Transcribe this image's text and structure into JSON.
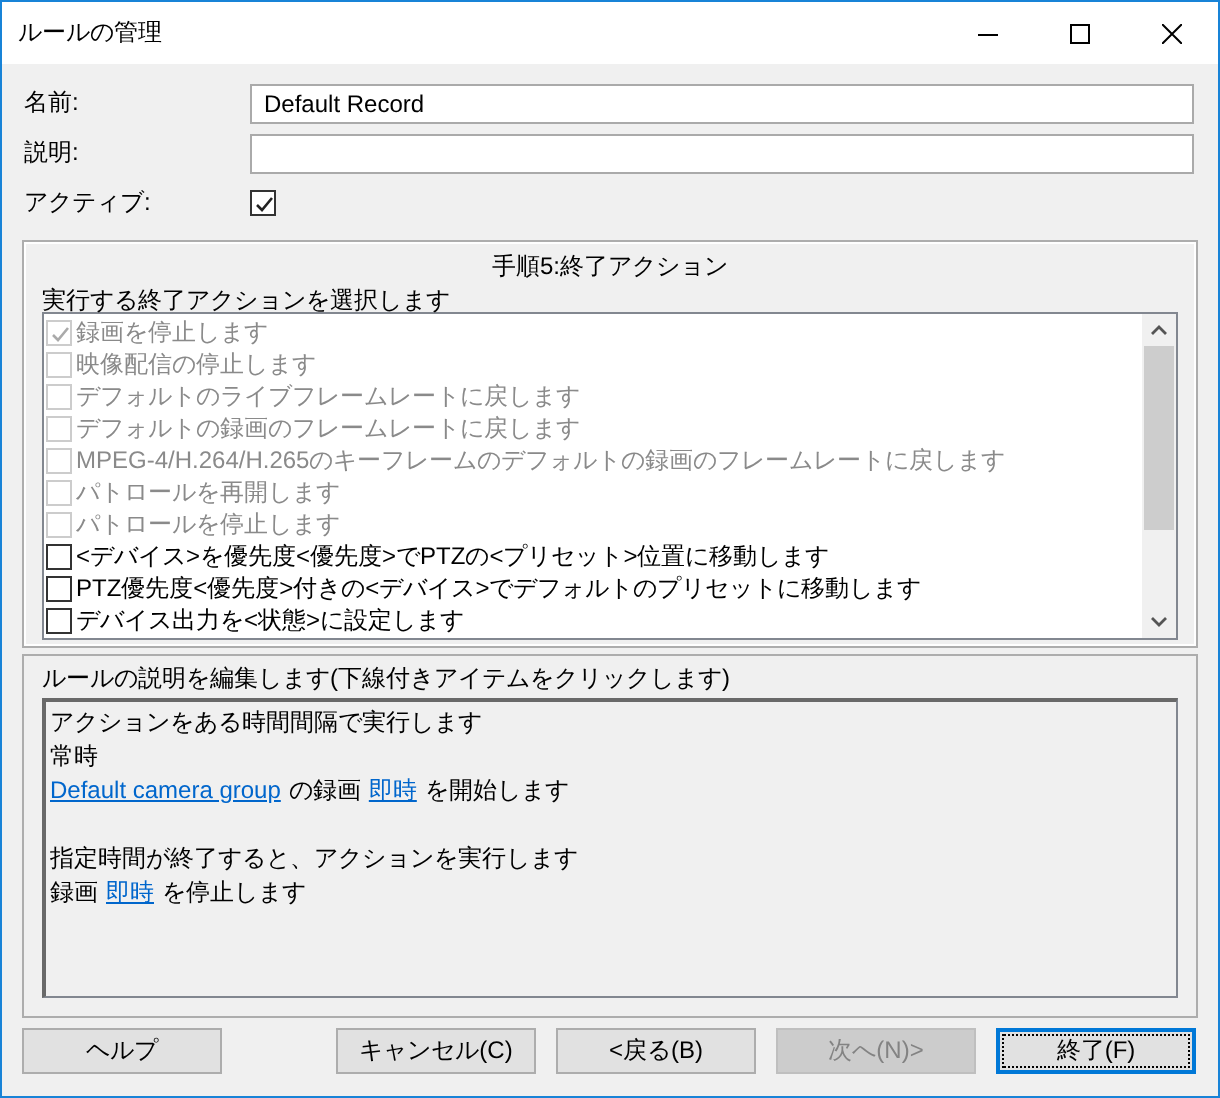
{
  "window": {
    "title": "ルールの管理"
  },
  "fields": [
    {
      "kind": "text",
      "label": "名前:",
      "value": "Default Record"
    },
    {
      "kind": "text",
      "label": "説明:"
    },
    {
      "kind": "checkbox",
      "label": "アクティブ:",
      "checked": true
    }
  ],
  "step": {
    "title": "手順5:終了アクション",
    "prompt": "実行する終了アクションを選択します",
    "actions": [
      {
        "label": "録画を停止します",
        "checked": true,
        "disabled": true
      },
      {
        "label": "映像配信の停止します",
        "checked": false,
        "disabled": true
      },
      {
        "label": "デフォルトのライブフレームレートに戻します",
        "checked": false,
        "disabled": true
      },
      {
        "label": "デフォルトの録画のフレームレートに戻します",
        "checked": false,
        "disabled": true
      },
      {
        "label": "MPEG-4/H.264/H.265のキーフレームのデフォルトの録画のフレームレートに戻します",
        "checked": false,
        "disabled": true
      },
      {
        "label": "パトロールを再開します",
        "checked": false,
        "disabled": true
      },
      {
        "label": "パトロールを停止します",
        "checked": false,
        "disabled": true
      },
      {
        "label": "<デバイス>を優先度<優先度>でPTZの<プリセット>位置に移動します",
        "checked": false,
        "disabled": false
      },
      {
        "label": "PTZ優先度<優先度>付きの<デバイス>でデフォルトのプリセットに移動します",
        "checked": false,
        "disabled": false
      },
      {
        "label": "デバイス出力を<状態>に設定します",
        "checked": false,
        "disabled": false
      }
    ]
  },
  "description": {
    "title": "ルールの説明を編集します(下線付きアイテムをクリックします)",
    "paragraphs": [
      [
        [
          {
            "kind": "text",
            "text": "アクションをある時間間隔で実行します"
          }
        ],
        [
          {
            "kind": "text",
            "text": "常時"
          }
        ],
        [
          {
            "kind": "link",
            "text": "Default camera group"
          },
          {
            "kind": "text",
            "text": "の録画"
          },
          {
            "kind": "link",
            "text": "即時"
          },
          {
            "kind": "text",
            "text": "を開始します"
          }
        ]
      ],
      [
        [
          {
            "kind": "text",
            "text": "指定時間が終了すると、アクションを実行します"
          }
        ],
        [
          {
            "kind": "text",
            "text": "録画"
          },
          {
            "kind": "link",
            "text": "即時"
          },
          {
            "kind": "text",
            "text": "を停止します"
          }
        ]
      ]
    ]
  },
  "buttons": [
    {
      "label": "ヘルプ",
      "disabled": false,
      "default": false
    },
    {
      "label": "キャンセル(C)",
      "disabled": false,
      "default": false
    },
    {
      "label": "<戻る(B)",
      "disabled": false,
      "default": false
    },
    {
      "label": "次へ(N)>",
      "disabled": true,
      "default": false
    },
    {
      "label": "終了(F)",
      "disabled": false,
      "default": true
    }
  ]
}
